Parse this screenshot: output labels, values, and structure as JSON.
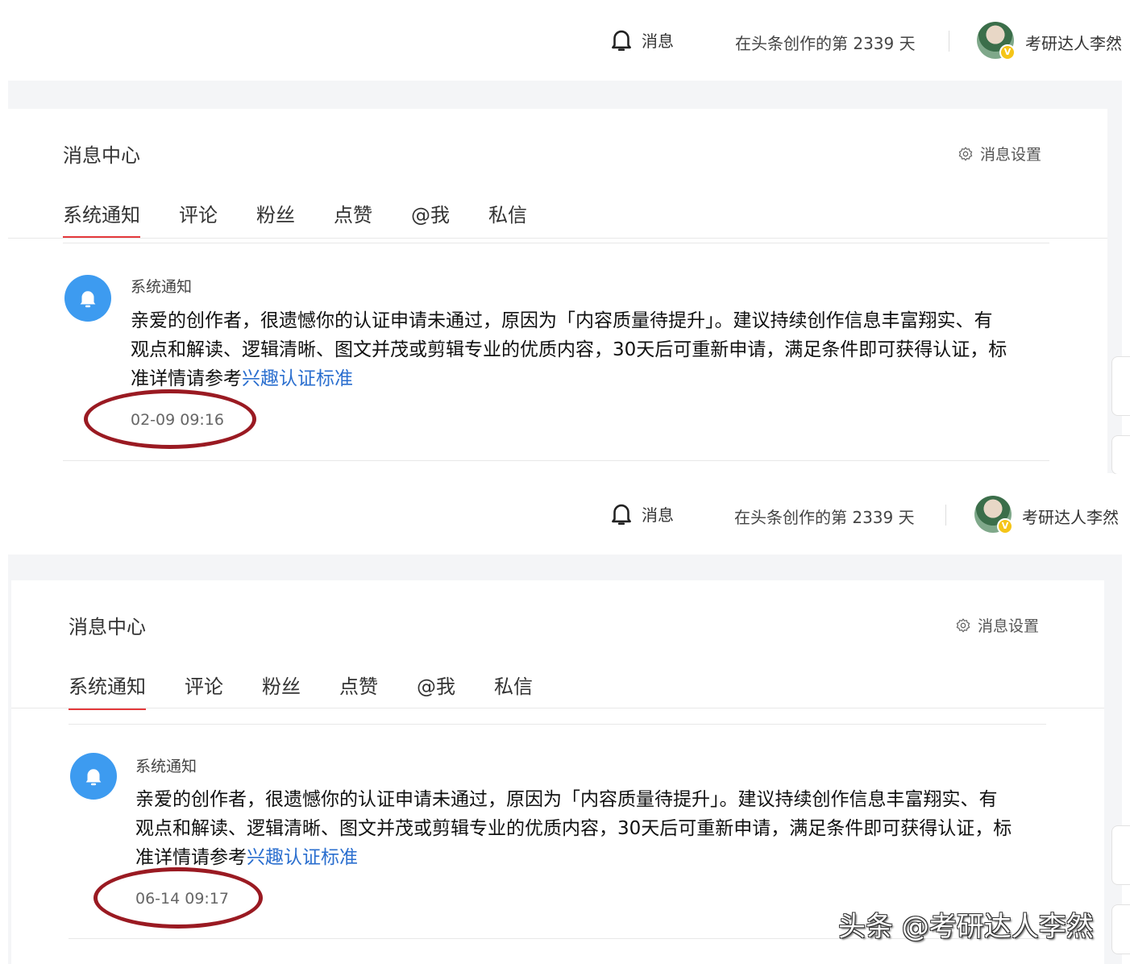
{
  "screens": [
    {
      "header": {
        "bell_label": "消息",
        "days_text": "在头条创作的第 2339 天",
        "username": "考研达人李然"
      },
      "message_center": {
        "title": "消息中心",
        "settings_label": "消息设置",
        "tabs": [
          "系统通知",
          "评论",
          "粉丝",
          "点赞",
          "@我",
          "私信"
        ],
        "active_tab": "系统通知"
      },
      "notification": {
        "title": "系统通知",
        "body_line1": "亲爱的创作者，很遗憾你的认证申请未通过，原因为「内容质量待提升」。建议持续创作信息丰富翔实、有",
        "body_line2": "观点和解读、逻辑清晰、图文并茂或剪辑专业的优质内容，30天后可重新申请，满足条件即可获得认证，标",
        "body_line3_prefix": "准详情请参考",
        "link_text": "兴趣认证标准",
        "time": "02-09 09:16"
      }
    },
    {
      "header": {
        "bell_label": "消息",
        "days_text": "在头条创作的第 2339 天",
        "username": "考研达人李然"
      },
      "message_center": {
        "title": "消息中心",
        "settings_label": "消息设置",
        "tabs": [
          "系统通知",
          "评论",
          "粉丝",
          "点赞",
          "@我",
          "私信"
        ],
        "active_tab": "系统通知"
      },
      "notification": {
        "title": "系统通知",
        "body_line1": "亲爱的创作者，很遗憾你的认证申请未通过，原因为「内容质量待提升」。建议持续创作信息丰富翔实、有",
        "body_line2": "观点和解读、逻辑清晰、图文并茂或剪辑专业的优质内容，30天后可重新申请，满足条件即可获得认证，标",
        "body_line3_prefix": "准详情请参考",
        "link_text": "兴趣认证标准",
        "time": "06-14 09:17"
      }
    }
  ],
  "watermark": "头条 @考研达人李然",
  "colors": {
    "active_tab_underline": "#e4393c",
    "link": "#2b6fcf",
    "notif_icon_bg": "#3d9bf0",
    "annotation_circle": "#9a1a22"
  },
  "icons": {
    "bell": "bell-icon",
    "settings": "gear-icon",
    "notification": "bell-icon"
  }
}
